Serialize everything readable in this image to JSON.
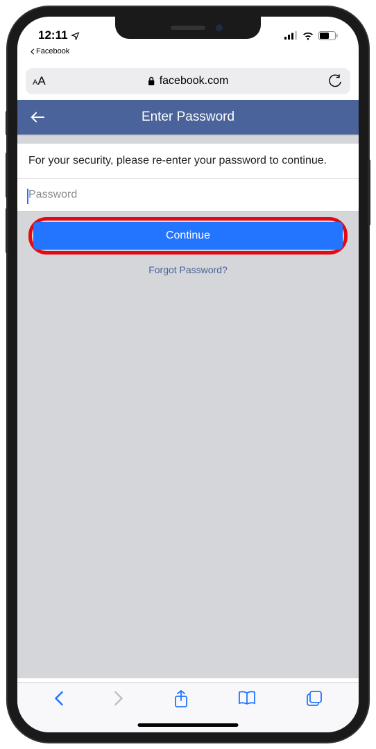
{
  "status": {
    "time": "12:11",
    "breadcrumb": "Facebook"
  },
  "safari": {
    "domain": "facebook.com"
  },
  "fb": {
    "header_title": "Enter Password",
    "prompt": "For your security, please re-enter your password to continue.",
    "password_placeholder": "Password",
    "continue_label": "Continue",
    "forgot_label": "Forgot Password?"
  }
}
